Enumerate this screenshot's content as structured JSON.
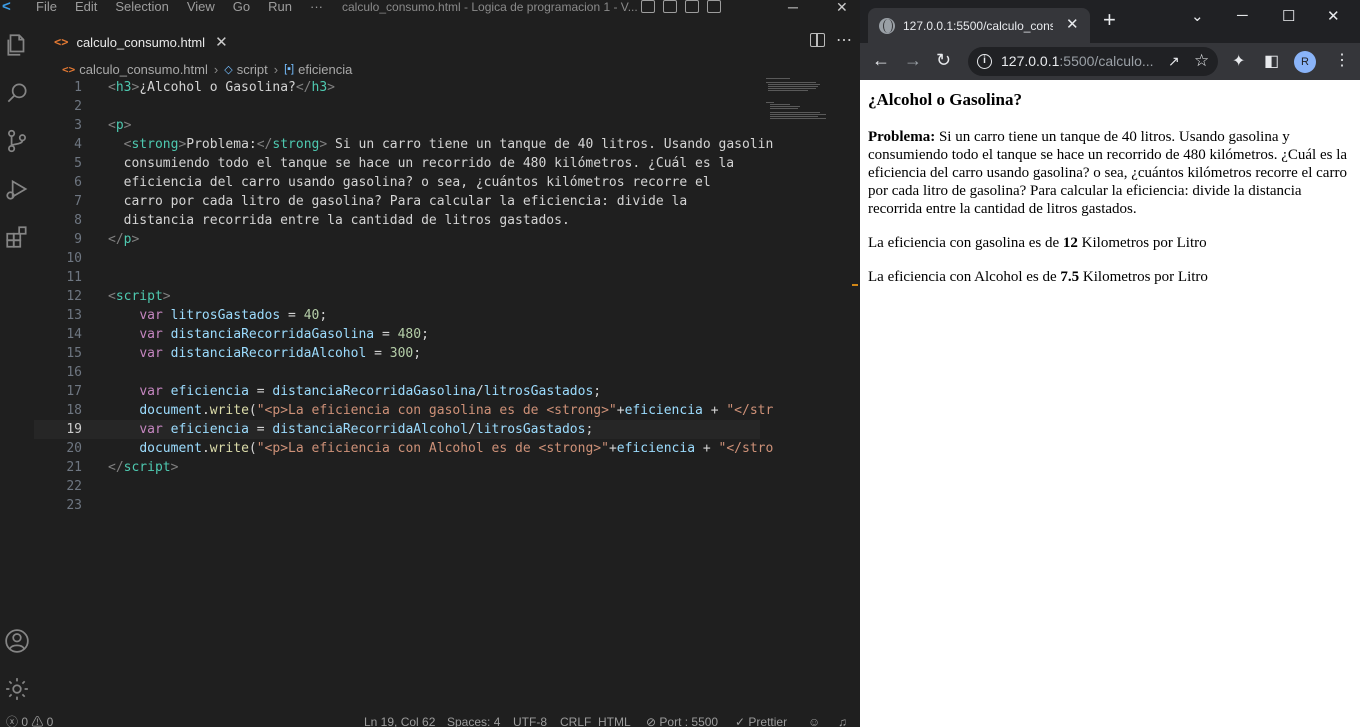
{
  "vscode": {
    "menu": [
      "File",
      "Edit",
      "Selection",
      "View",
      "Go",
      "Run",
      "···"
    ],
    "window_title": "calculo_consumo.html - Logica de programacion 1 - V...",
    "tab": {
      "filename": "calculo_consumo.html",
      "icon_text": "<>"
    },
    "breadcrumb": [
      "calculo_consumo.html",
      "script",
      "eficiencia"
    ],
    "current_line": 19,
    "code_lines": [
      {
        "n": 1
      },
      {
        "n": 2
      },
      {
        "n": 3
      },
      {
        "n": 4
      },
      {
        "n": 5
      },
      {
        "n": 6
      },
      {
        "n": 7
      },
      {
        "n": 8
      },
      {
        "n": 9
      },
      {
        "n": 10
      },
      {
        "n": 11
      },
      {
        "n": 12
      },
      {
        "n": 13
      },
      {
        "n": 14
      },
      {
        "n": 15
      },
      {
        "n": 16
      },
      {
        "n": 17
      },
      {
        "n": 18
      },
      {
        "n": 19
      },
      {
        "n": 20
      },
      {
        "n": 21
      },
      {
        "n": 22
      },
      {
        "n": 23
      }
    ],
    "code_text": {
      "l1_title": "¿Alcohol o Gasolina?",
      "l4_strong": "Problema:",
      "l4_text": " Si un carro tiene un tanque de 40 litros. Usando gasolin",
      "l5": "  consumiendo todo el tanque se hace un recorrido de 480 kilómetros. ¿Cuál es la",
      "l6": "  eficiencia del carro usando gasolina? o sea, ¿cuántos kilómetros recorre el",
      "l7": "  carro por cada litro de gasolina? Para calcular la eficiencia: divide la",
      "l8": "  distancia recorrida entre la cantidad de litros gastados.",
      "v1": "litrosGastados",
      "n1": "40",
      "v2": "distanciaRecorridaGasolina",
      "n2": "480",
      "v3": "distanciaRecorridaAlcohol",
      "n3": "300",
      "v4": "eficiencia",
      "l18_str1": "\"<p>La eficiencia con gasolina es de <strong>\"",
      "l18_str2": "\"</str",
      "l20_str1": "\"<p>La eficiencia con Alcohol es de <strong>\"",
      "l20_str2": "\"</stro"
    },
    "status": {
      "errors": "ⓧ 0 ⚠ 0",
      "position": "Ln 19, Col 62",
      "spaces": "Spaces: 4",
      "encoding": "UTF-8",
      "eol": "CRLF",
      "language": "HTML",
      "port": "⊘ Port : 5500",
      "prettier": "✓ Prettier"
    }
  },
  "chrome": {
    "tab_title": "127.0.0.1:5500/calculo_consu",
    "url_host": "127.0.0.1",
    "url_rest": ":5500/calculo...",
    "avatar_letter": "R",
    "page": {
      "heading": "¿Alcohol o Gasolina?",
      "problem_label": "Problema:",
      "problem_text": " Si un carro tiene un tanque de 40 litros. Usando gasolina y consumiendo todo el tanque se hace un recorrido de 480 kilómetros. ¿Cuál es la eficiencia del carro usando gasolina? o sea, ¿cuántos kilómetros recorre el carro por cada litro de gasolina? Para calcular la eficiencia: divide la distancia recorrida entre la cantidad de litros gastados.",
      "gas_prefix": "La eficiencia con gasolina es de ",
      "gas_value": "12",
      "gas_suffix": " Kilometros por Litro",
      "alc_prefix": "La eficiencia con Alcohol es de ",
      "alc_value": "7.5",
      "alc_suffix": " Kilometros por Litro"
    }
  }
}
